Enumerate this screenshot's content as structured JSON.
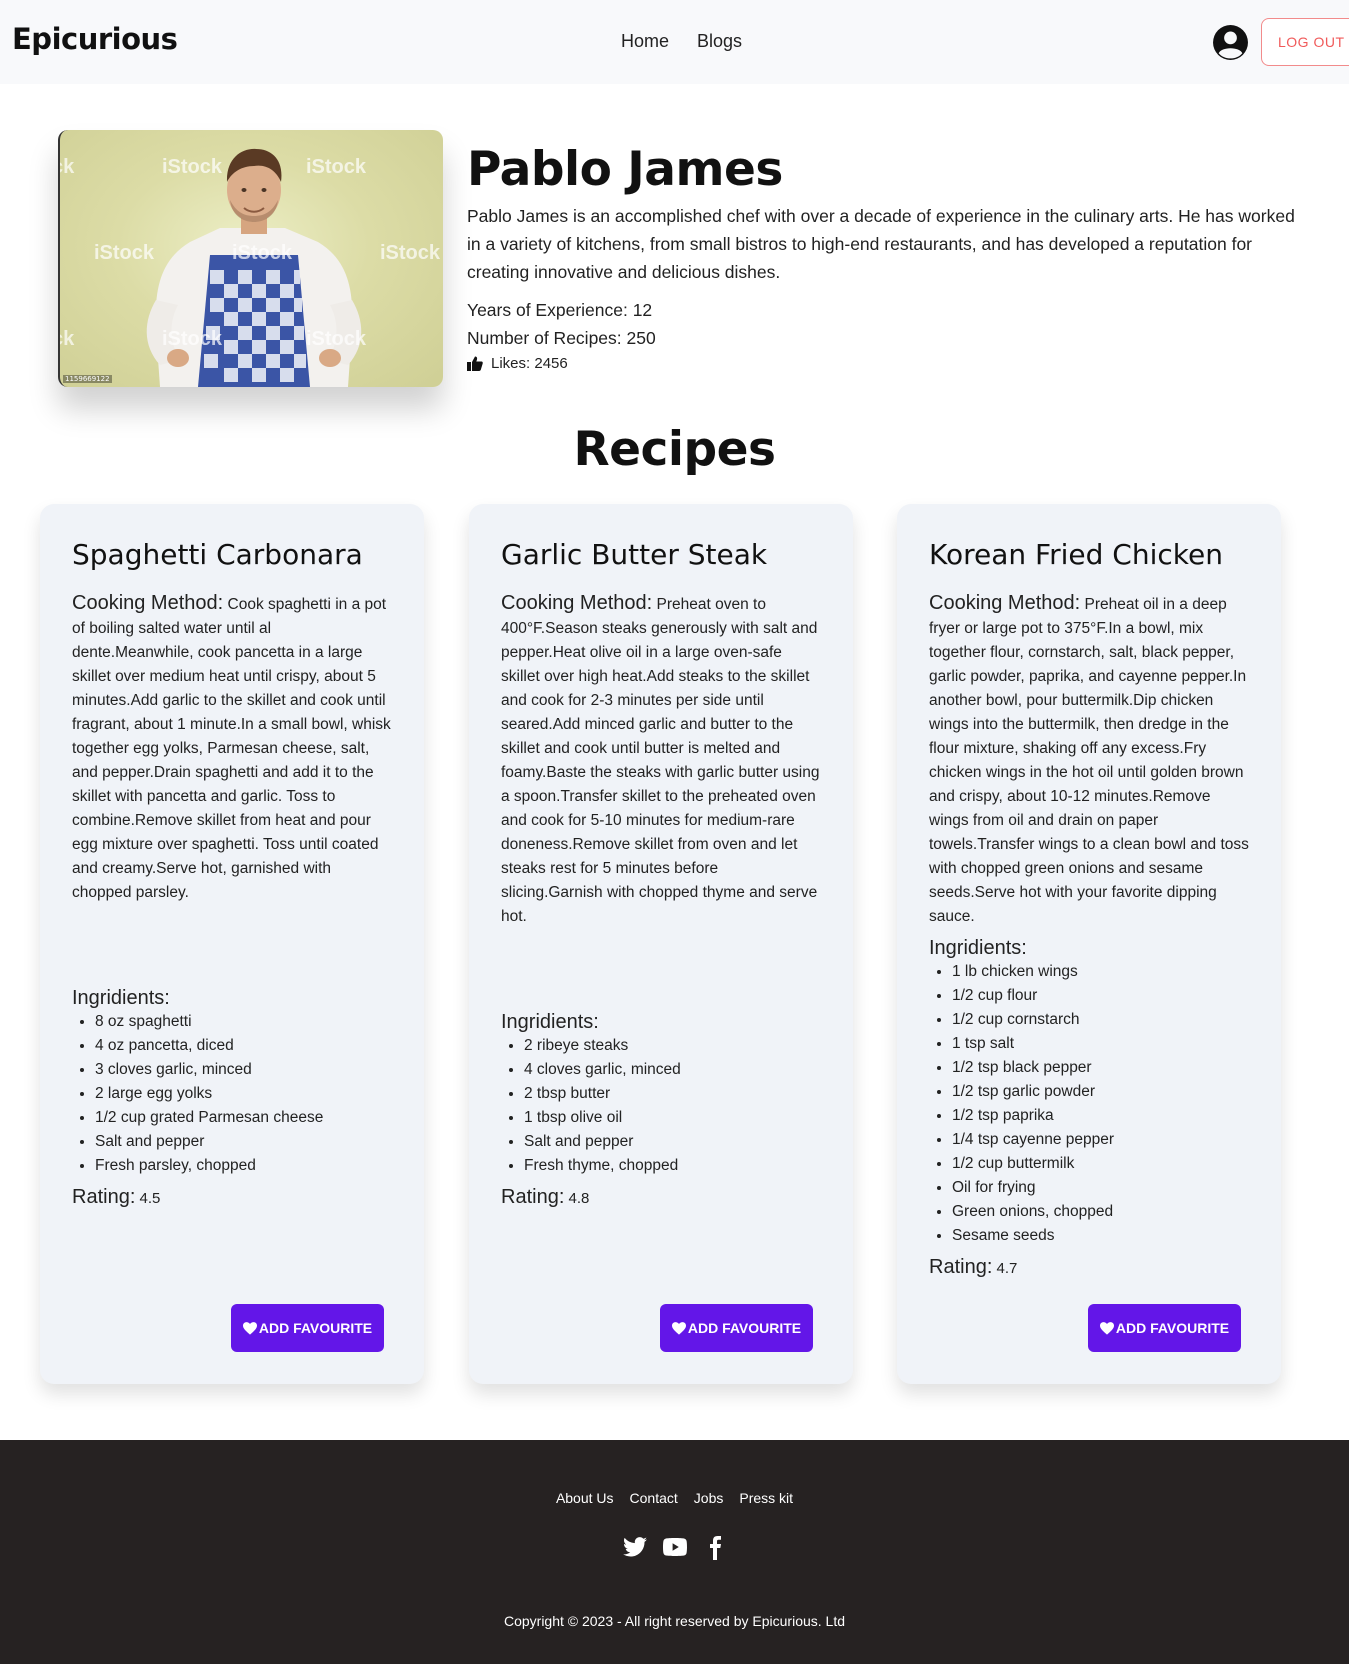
{
  "navbar": {
    "brand": "Epicurious",
    "links": [
      "Home",
      "Blogs"
    ],
    "logout_label": "LOG OUT"
  },
  "profile": {
    "watermark": "iStock",
    "photo_id": "1159669122",
    "name": "Pablo James",
    "bio": "Pablo James is an accomplished chef with over a decade of experience in the culinary arts. He has worked in a variety of kitchens, from small bistros to high-end restaurants, and has developed a reputation for creating innovative and delicious dishes.",
    "experience": "Years of Experience: 12",
    "recipes_count": "Number of Recipes: 250",
    "likes": "Likes: 2456"
  },
  "recipes_title": "Recipes",
  "labels": {
    "method": "Cooking Method:",
    "ingredients": "Ingridients:",
    "rating": "Rating:",
    "fav_button": "ADD FAVOURITE"
  },
  "recipes": [
    {
      "title": "Spaghetti Carbonara",
      "method": "Cook spaghetti in a pot of boiling salted water until al dente.Meanwhile, cook pancetta in a large skillet over medium heat until crispy, about 5 minutes.Add garlic to the skillet and cook until fragrant, about 1 minute.In a small bowl, whisk together egg yolks, Parmesan cheese, salt, and pepper.Drain spaghetti and add it to the skillet with pancetta and garlic. Toss to combine.Remove skillet from heat and pour egg mixture over spaghetti. Toss until coated and creamy.Serve hot, garnished with chopped parsley.",
      "ingredients": [
        "8 oz spaghetti",
        "4 oz pancetta, diced",
        "3 cloves garlic, minced",
        "2 large egg yolks",
        "1/2 cup grated Parmesan cheese",
        "Salt and pepper",
        "Fresh parsley, chopped"
      ],
      "rating": "4.5"
    },
    {
      "title": "Garlic Butter Steak",
      "method": "Preheat oven to 400°F.Season steaks generously with salt and pepper.Heat olive oil in a large oven-safe skillet over high heat.Add steaks to the skillet and cook for 2-3 minutes per side until seared.Add minced garlic and butter to the skillet and cook until butter is melted and foamy.Baste the steaks with garlic butter using a spoon.Transfer skillet to the preheated oven and cook for 5-10 minutes for medium-rare doneness.Remove skillet from oven and let steaks rest for 5 minutes before slicing.Garnish with chopped thyme and serve hot.",
      "ingredients": [
        "2 ribeye steaks",
        "4 cloves garlic, minced",
        "2 tbsp butter",
        "1 tbsp olive oil",
        "Salt and pepper",
        "Fresh thyme, chopped"
      ],
      "rating": "4.8"
    },
    {
      "title": "Korean Fried Chicken",
      "method": "Preheat oil in a deep fryer or large pot to 375°F.In a bowl, mix together flour, cornstarch, salt, black pepper, garlic powder, paprika, and cayenne pepper.In another bowl, pour buttermilk.Dip chicken wings into the buttermilk, then dredge in the flour mixture, shaking off any excess.Fry chicken wings in the hot oil until golden brown and crispy, about 10-12 minutes.Remove wings from oil and drain on paper towels.Transfer wings to a clean bowl and toss with chopped green onions and sesame seeds.Serve hot with your favorite dipping sauce.",
      "ingredients": [
        "1 lb chicken wings",
        "1/2 cup flour",
        "1/2 cup cornstarch",
        "1 tsp salt",
        "1/2 tsp black pepper",
        "1/2 tsp garlic powder",
        "1/2 tsp paprika",
        "1/4 tsp cayenne pepper",
        "1/2 cup buttermilk",
        "Oil for frying",
        "Green onions, chopped",
        "Sesame seeds"
      ],
      "rating": "4.7"
    }
  ],
  "footer": {
    "links": [
      "About Us",
      "Contact",
      "Jobs",
      "Press kit"
    ],
    "socials": [
      "twitter-icon",
      "youtube-icon",
      "facebook-icon"
    ],
    "copyright": "Copyright © 2023 - All right reserved by Epicurious. Ltd"
  },
  "colors": {
    "accent": "#6316e8",
    "logout": "#f05a5a",
    "footer_bg": "#262222",
    "card_bg": "#f0f3f8"
  }
}
